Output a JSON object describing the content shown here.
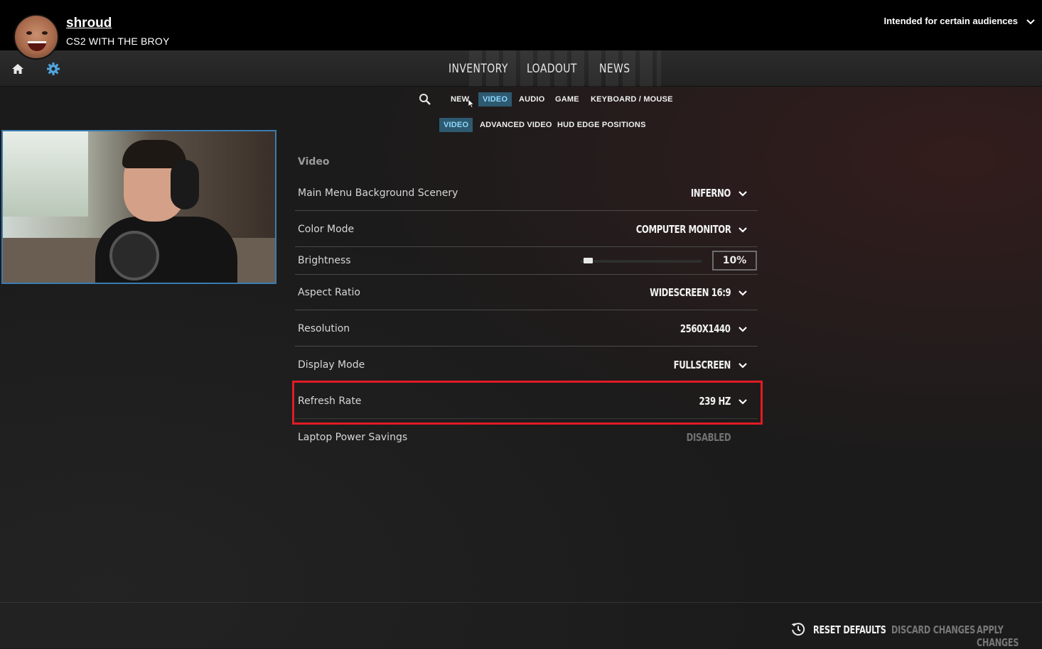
{
  "stream": {
    "channel_name": "shroud",
    "title": "CS2 WITH THE BROY",
    "audience_notice": "Intended for certain audiences"
  },
  "icons": {
    "home": "home-icon",
    "settings": "gear-icon",
    "search": "search-icon",
    "chevron": "chevron-down-icon",
    "reset": "reset-history-icon"
  },
  "main_nav": [
    "INVENTORY",
    "LOADOUT",
    "NEWS"
  ],
  "settings_tabs": [
    "NEW",
    "VIDEO",
    "AUDIO",
    "GAME",
    "KEYBOARD / MOUSE"
  ],
  "settings_tabs_active": "VIDEO",
  "video_tabs": [
    "VIDEO",
    "ADVANCED VIDEO",
    "HUD EDGE POSITIONS"
  ],
  "video_tabs_active": "VIDEO",
  "section_title": "Video",
  "settings": [
    {
      "label": "Main Menu Background Scenery",
      "value": "INFERNO"
    },
    {
      "label": "Color Mode",
      "value": "COMPUTER MONITOR"
    },
    {
      "label": "Brightness",
      "value": "10%",
      "slider_fraction": 0.1
    },
    {
      "label": "Aspect Ratio",
      "value": "WIDESCREEN 16:9"
    },
    {
      "label": "Resolution",
      "value": "2560X1440"
    },
    {
      "label": "Display Mode",
      "value": "FULLSCREEN"
    },
    {
      "label": "Refresh Rate",
      "value": "239 HZ"
    },
    {
      "label": "Laptop Power Savings",
      "value": "DISABLED"
    }
  ],
  "footer": {
    "reset": "RESET DEFAULTS",
    "discard": "DISCARD CHANGES",
    "apply": "APPLY CHANGES"
  },
  "colors": {
    "active_tab_bg": "#2d5a70",
    "active_tab_text": "#8fd8ff",
    "highlight": "#e01b24",
    "webcam_border": "#3b7bb0"
  }
}
